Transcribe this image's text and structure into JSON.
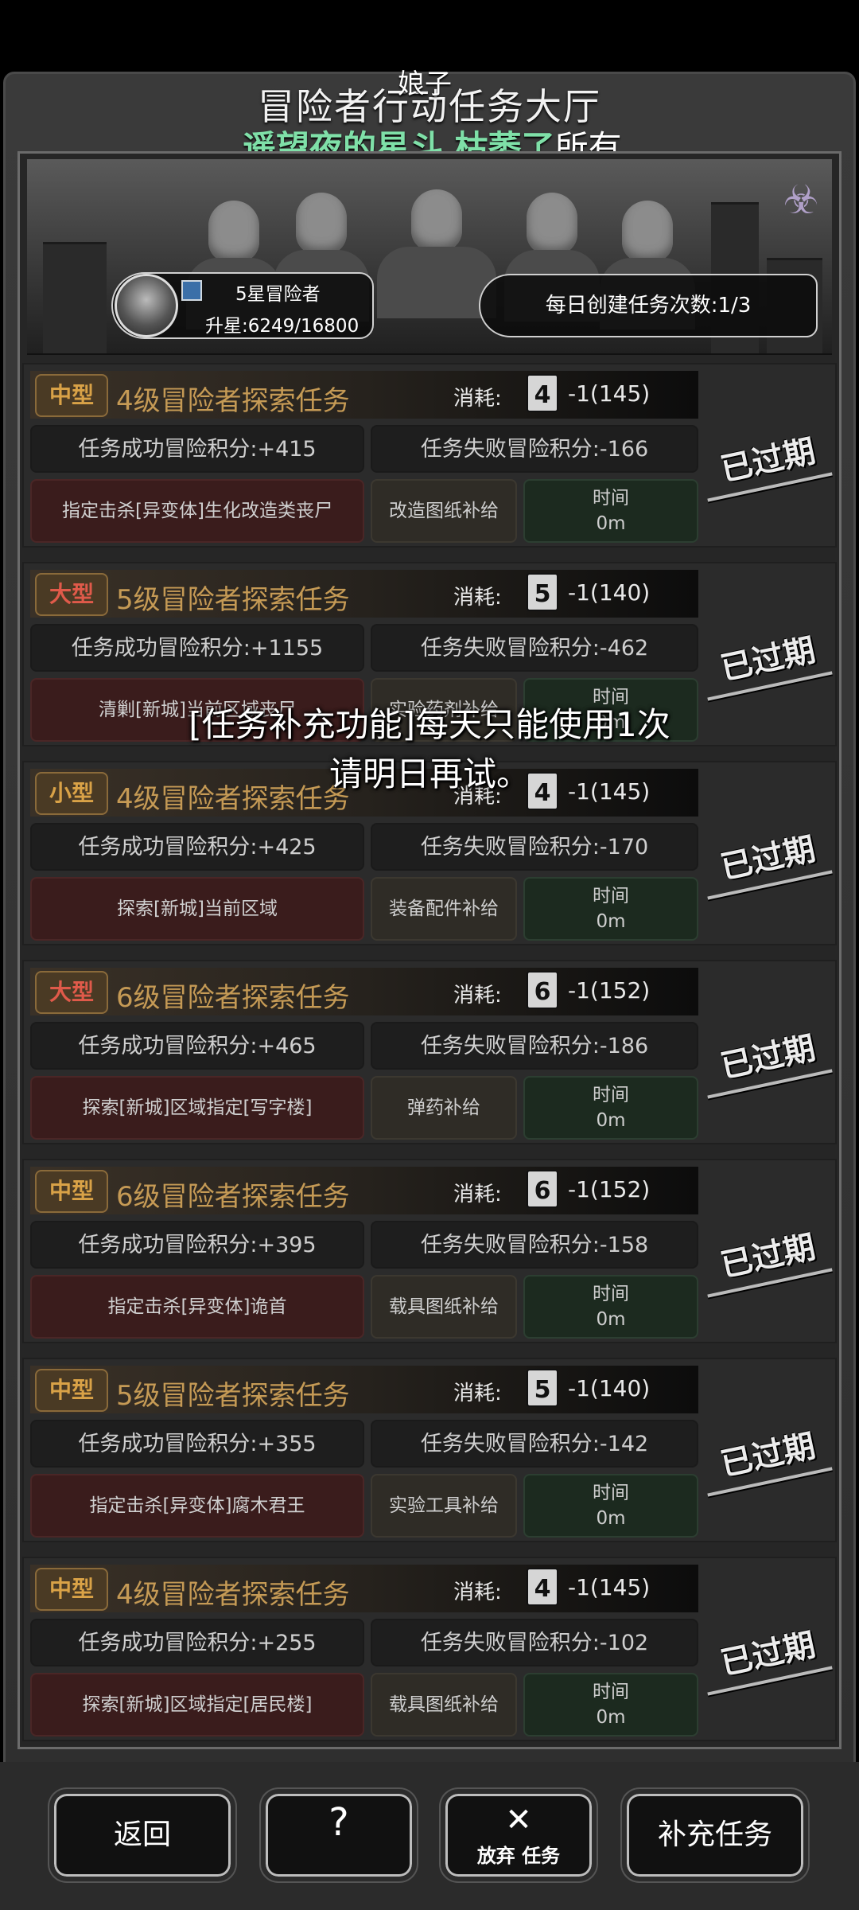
{
  "header": {
    "scroll_name": "娘子",
    "title": "冒险者行动任务大厅",
    "scroll_text": "遥望夜的星斗 枯萎了",
    "scroll_text_tail": "所有"
  },
  "profile": {
    "rank_name": "5星冒险者",
    "exp": "升星:6249/16800",
    "daily": "每日创建任务次数:1/3"
  },
  "tasks": [
    {
      "size": "中型",
      "size_color": "#d9a247",
      "name": "4级冒险者探索任务",
      "cost_label": "消耗:",
      "lv": "4",
      "cost": "-1(145)",
      "success": "任务成功冒险积分:+415",
      "fail": "任务失败冒险积分:-166",
      "target": "指定击杀[异变体]生化改造类丧尸",
      "supply": "改造图纸补给",
      "time_label": "时间",
      "time_value": "0m",
      "status": "已过期"
    },
    {
      "size": "大型",
      "size_color": "#e05a4a",
      "name": "5级冒险者探索任务",
      "cost_label": "消耗:",
      "lv": "5",
      "cost": "-1(140)",
      "success": "任务成功冒险积分:+1155",
      "fail": "任务失败冒险积分:-462",
      "target": "清剿[新城]当前区域丧尸",
      "supply": "实验药剂补给",
      "time_label": "时间",
      "time_value": "0m",
      "status": "已过期"
    },
    {
      "size": "小型",
      "size_color": "#d9a247",
      "name": "4级冒险者探索任务",
      "cost_label": "消耗:",
      "lv": "4",
      "cost": "-1(145)",
      "success": "任务成功冒险积分:+425",
      "fail": "任务失败冒险积分:-170",
      "target": "探索[新城]当前区域",
      "supply": "装备配件补给",
      "time_label": "时间",
      "time_value": "0m",
      "status": "已过期"
    },
    {
      "size": "大型",
      "size_color": "#e05a4a",
      "name": "6级冒险者探索任务",
      "cost_label": "消耗:",
      "lv": "6",
      "cost": "-1(152)",
      "success": "任务成功冒险积分:+465",
      "fail": "任务失败冒险积分:-186",
      "target": "探索[新城]区域指定[写字楼]",
      "supply": "弹药补给",
      "time_label": "时间",
      "time_value": "0m",
      "status": "已过期"
    },
    {
      "size": "中型",
      "size_color": "#d9a247",
      "name": "6级冒险者探索任务",
      "cost_label": "消耗:",
      "lv": "6",
      "cost": "-1(152)",
      "success": "任务成功冒险积分:+395",
      "fail": "任务失败冒险积分:-158",
      "target": "指定击杀[异变体]诡首",
      "supply": "载具图纸补给",
      "time_label": "时间",
      "time_value": "0m",
      "status": "已过期"
    },
    {
      "size": "中型",
      "size_color": "#d9a247",
      "name": "5级冒险者探索任务",
      "cost_label": "消耗:",
      "lv": "5",
      "cost": "-1(140)",
      "success": "任务成功冒险积分:+355",
      "fail": "任务失败冒险积分:-142",
      "target": "指定击杀[异变体]腐木君王",
      "supply": "实验工具补给",
      "time_label": "时间",
      "time_value": "0m",
      "status": "已过期"
    },
    {
      "size": "中型",
      "size_color": "#d9a247",
      "name": "4级冒险者探索任务",
      "cost_label": "消耗:",
      "lv": "4",
      "cost": "-1(145)",
      "success": "任务成功冒险积分:+255",
      "fail": "任务失败冒险积分:-102",
      "target": "探索[新城]区域指定[居民楼]",
      "supply": "载具图纸补给",
      "time_label": "时间",
      "time_value": "0m",
      "status": "已过期"
    }
  ],
  "toast": {
    "line1": "[任务补充功能]每天只能使用1次",
    "line2": "请明日再试。"
  },
  "buttons": {
    "back": "返回",
    "help_icon": "?",
    "abandon_icon": "✕",
    "abandon": "放弃 任务",
    "replenish": "补充任务"
  },
  "icons": {
    "corner": "corner-ornament-icon",
    "faction": "biohazard-icon",
    "help": "question-icon",
    "abandon": "close-icon",
    "rank": "rank-badge-icon"
  }
}
